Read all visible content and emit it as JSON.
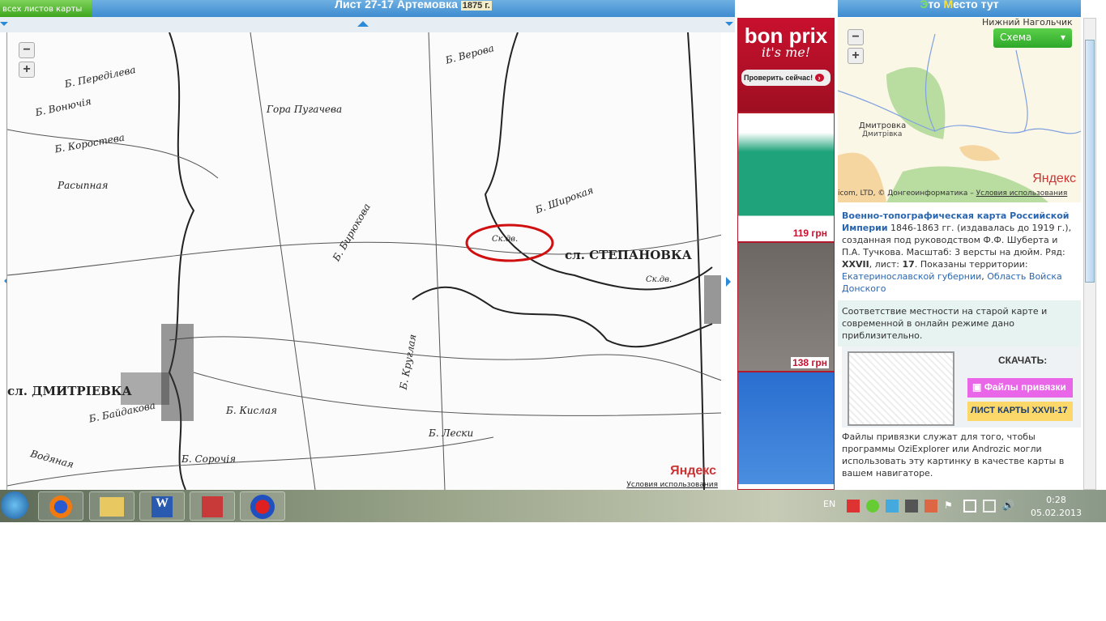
{
  "header": {
    "all_sheets": "всех листов карты",
    "title": "Лист 27-17   Артемовка",
    "year": "1875 г.",
    "right_title_e": "Э",
    "right_title_1": "то ",
    "right_title_m": "М",
    "right_title_2": "есто тут"
  },
  "map": {
    "labels": [
      "сл. СТЕПАНОВКА",
      "сл. ДМИТРІЕВКА",
      "Ск.дв.",
      "Гора Пугачева",
      "Б. Коростева",
      "Б. Верова",
      "Б. Широкая",
      "Расыпная",
      "Б. Вонючія",
      "Б. Переділева",
      "Б. Бирюкова",
      "Б. Кислая",
      "Б. Сорочія",
      "Водяная",
      "Б. Лески",
      "Б. Круглая",
      "Б. Байдакова",
      "Ск.дв."
    ],
    "watermark": "Яндекс",
    "terms": "Условия использования",
    "zoom_in": "+",
    "zoom_out": "−"
  },
  "ad": {
    "brand": "bon prix",
    "slogan": "it's me!",
    "cta": "Проверить сейчас!",
    "prices": [
      "119 грн",
      "138 грн"
    ]
  },
  "ymap": {
    "type": "Схема",
    "city": "Дмитровка",
    "city_ua": "Дмитрівка",
    "top_label": "Нижний Нагольчик",
    "logo": "Яндекс",
    "copyright": "icom, LTD, © Донгеоинформатика –",
    "terms": "Условия использования",
    "zoom_in": "+",
    "zoom_out": "−"
  },
  "info": {
    "title": "Военно-топографическая карта Российской Империи",
    "t1": " 1846-1863 гг. (издавалась до 1919 г.), созданная под руководством Ф.Ф. Шуберта и П.А. Тучкова. Масштаб: 3 версты на дюйм. Ряд: ",
    "row": "XXVII",
    "t2": ", лист: ",
    "sheet": "17",
    "t3": ". Показаны территории: ",
    "terr1": "Екатеринославской губернии",
    "sep": ", ",
    "terr2": "Область Войска Донского",
    "note": "Соответствие местности на старой карте и современной в онлайн режиме дано приблизительно.",
    "download": "СКАЧАТЬ:",
    "btn_files": "Файлы привязки",
    "btn_sheet": "ЛИСТ КАРТЫ XXVII-17",
    "files_note": "Файлы привязки служат для того, чтобы программы OziExplorer или Androzic могли использовать эту картинку в качестве карты в вашем навигаторе."
  },
  "taskbar": {
    "lang": "EN",
    "time": "0:28",
    "date": "05.02.2013",
    "apps": [
      "start",
      "firefox",
      "explorer",
      "word",
      "kaspersky",
      "kiev"
    ]
  }
}
